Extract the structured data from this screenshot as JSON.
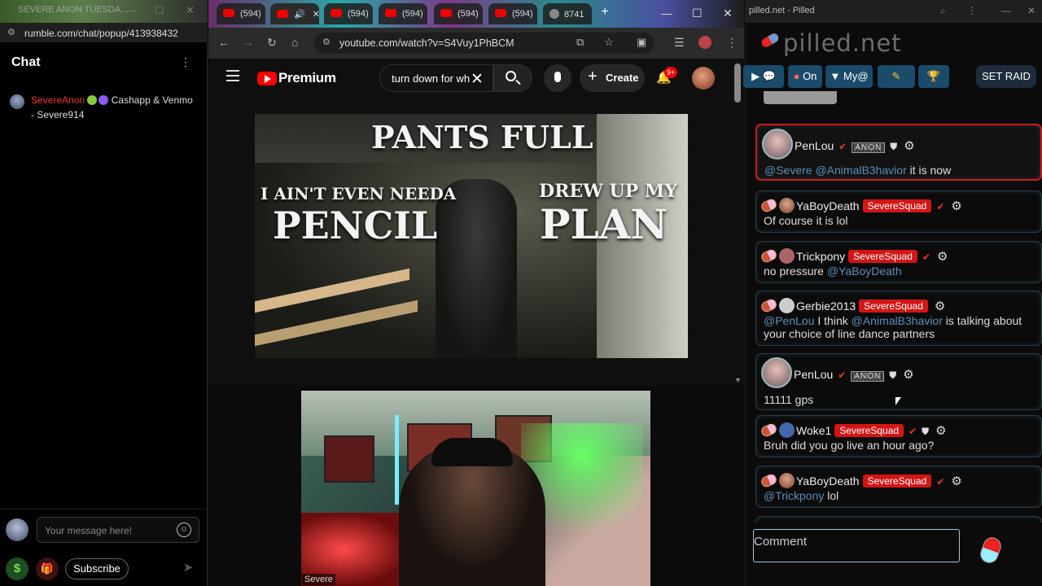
{
  "left_window": {
    "title": "SEVERE ANON TUESDA...",
    "url": "rumble.com/chat/popup/413938432",
    "chat_title": "Chat",
    "message": {
      "username": "SevereAnon",
      "text": "Cashapp & Venmo - Severe914"
    },
    "input_placeholder": "Your message here!",
    "subscribe_label": "Subscribe",
    "dollar_label": "$"
  },
  "browser": {
    "tabs": [
      {
        "label": "(594)"
      },
      {
        "label": "",
        "active": true
      },
      {
        "label": "(594)"
      },
      {
        "label": "(594)"
      },
      {
        "label": "(594)"
      },
      {
        "label": "(594)"
      },
      {
        "label": "8741"
      }
    ],
    "url": "youtube.com/watch?v=S4Vuy1PhBCM",
    "brand": "Premium",
    "search_value": "turn down for wh",
    "create_label": "Create",
    "notifications": "9+",
    "video_text": {
      "top": "PANTS FULL",
      "left_small": "I AIN'T EVEN NEEDA",
      "left_big": "PENCIL",
      "right_small": "DREW UP MY",
      "right_big": "PLAN"
    }
  },
  "webcam": {
    "label": "Severe"
  },
  "pilled": {
    "window_title": "pilled.net - Pilled",
    "logo": "pilled.net",
    "toolbar": {
      "on_label": "On",
      "my_label": "My@",
      "raid_label": "SET RAID"
    },
    "messages": [
      {
        "user": "PenLou",
        "badge": "ANON",
        "body_mentions": [
          "@Severe",
          "@AnimalB3havior"
        ],
        "body_text": "it is now"
      },
      {
        "user": "YaBoyDeath",
        "squad": "SevereSquad",
        "body_text": "Of course it is lol"
      },
      {
        "user": "Trickpony",
        "squad": "SevereSquad",
        "body_text": "no pressure",
        "body_mention": "@YaBoyDeath"
      },
      {
        "user": "Gerbie2013",
        "squad": "SevereSquad",
        "mention1": "@PenLou",
        "text1": "I think",
        "mention2": "@AnimalB3havior",
        "text2": "is talking about your choice of line dance partners"
      },
      {
        "user": "PenLou",
        "badge": "ANON",
        "body_text": "11111 gps"
      },
      {
        "user": "Woke1",
        "squad": "SevereSquad",
        "body_text": "Bruh did you go live an hour ago?"
      },
      {
        "user": "YaBoyDeath",
        "squad": "SevereSquad",
        "body_mention": "@Trickpony",
        "body_text": "lol"
      }
    ],
    "comment_placeholder": "Comment"
  }
}
